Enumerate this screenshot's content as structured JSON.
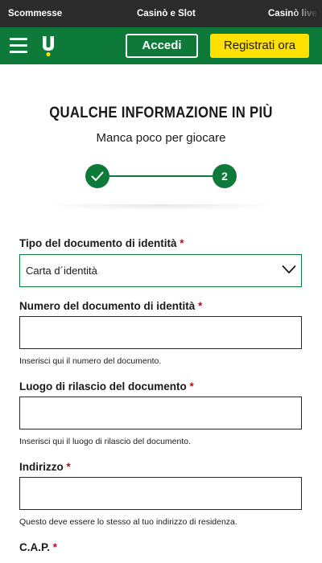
{
  "top_nav": {
    "tabs": [
      {
        "label": "Scommesse"
      },
      {
        "label": "Casinò e Slot"
      },
      {
        "label": "Casinò live"
      }
    ]
  },
  "header": {
    "login_label": "Accedi",
    "register_label": "Registrati ora",
    "brand_color": "#0d7a3a",
    "register_color": "#ffe000"
  },
  "intro": {
    "title": "QUALCHE INFORMAZIONE IN PIÙ",
    "subtitle": "Manca poco per giocare",
    "steps": [
      {
        "state": "completed",
        "icon": "check-icon"
      },
      {
        "state": "current",
        "label": "2"
      }
    ]
  },
  "form": {
    "doc_type": {
      "label": "Tipo del documento di identità",
      "required_mark": "*",
      "value": "Carta d´identità"
    },
    "doc_number": {
      "label": "Numero del documento di identità",
      "required_mark": "*",
      "value": "",
      "hint": "Inserisci qui il numero del documento."
    },
    "doc_place": {
      "label": "Luogo di rilascio del documento",
      "required_mark": "*",
      "value": "",
      "hint": "Inserisci qui il luogo di rilascio del documento."
    },
    "address": {
      "label": "Indirizzo",
      "required_mark": "*",
      "value": "",
      "hint": "Questo deve essere lo stesso al tuo indirizzo di residenza."
    },
    "cap": {
      "label": "C.A.P.",
      "required_mark": "*"
    }
  },
  "colors": {
    "required": "#d0021b",
    "topbar_bg": "#2b2b2b"
  }
}
